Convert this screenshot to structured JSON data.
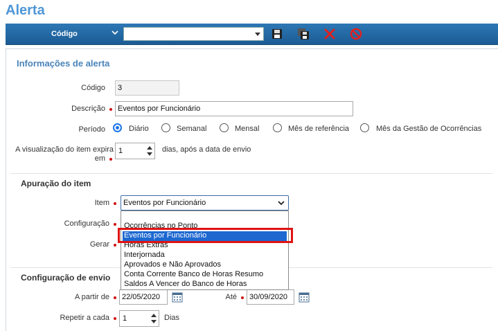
{
  "page": {
    "title": "Alerta"
  },
  "toolbar": {
    "label": "Código",
    "select_value": "",
    "icons": [
      "save-icon",
      "save-as-icon",
      "delete-icon",
      "cancel-icon"
    ]
  },
  "info": {
    "section_title": "Informações de alerta",
    "codigo_label": "Código",
    "codigo_value": "3",
    "descricao_label": "Descrição",
    "descricao_value": "Eventos por Funcionário",
    "periodo_label": "Período",
    "periodo_options": [
      "Diário",
      "Semanal",
      "Mensal",
      "Mês de referência",
      "Mês da Gestão de Ocorrências"
    ],
    "periodo_selected": "Diário",
    "expira_label_1": "A visualização do item expira",
    "expira_label_2": "em",
    "expira_value": "1",
    "expira_suffix": "dias, após a data de envio"
  },
  "apuracao": {
    "section_title": "Apuração do item",
    "item_label": "Item",
    "item_value": "Eventos por Funcionário",
    "configuracao_label": "Configuração",
    "gerar_label": "Gerar",
    "dropdown_options": [
      "Ocorrências no Ponto",
      "Eventos por Funcionário",
      "Horas Extras",
      "Interjornada",
      "Aprovados e Não Aprovados",
      "Conta Corrente Banco de Horas Resumo",
      "Saldos A Vencer do Banco de Horas"
    ],
    "dropdown_selected_index": 1
  },
  "envio": {
    "section_title": "Configuração de envio",
    "a_partir_label": "A partir de",
    "a_partir_value": "22/05/2020",
    "ate_label": "Até",
    "ate_value": "30/09/2020",
    "repetir_label": "Repetir a cada",
    "repetir_value": "1",
    "repetir_suffix": "Dias"
  },
  "colors": {
    "accent": "#4f96d6",
    "toolbar": "#2d78b5",
    "required": "#d01010",
    "highlight": "#e01313",
    "selection": "#1e68d0"
  }
}
